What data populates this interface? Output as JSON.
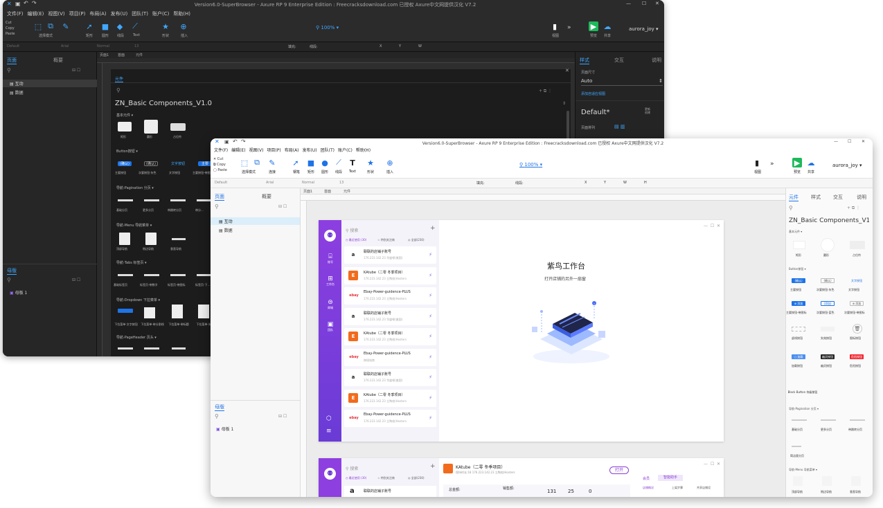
{
  "dark": {
    "title": "Version6.0-SuperBrowser - Axure RP 9 Enterprise Edition : Freecracksdownload.com 已授权   Axure中文网提供汉化 V7.2",
    "menus": [
      "文件(F)",
      "编辑(E)",
      "视图(V)",
      "项目(P)",
      "布局(A)",
      "发布(U)",
      "团队(T)",
      "账户(C)",
      "帮助(H)"
    ],
    "clip": [
      "Cut",
      "Copy",
      "Paste"
    ],
    "toolbar": {
      "select_mode": "选择模式",
      "connect": "连接",
      "pen": "钢笔",
      "rect": "矩形",
      "ellipse": "圆形",
      "line": "线段",
      "text": "Text",
      "shape": "形状",
      "insert": "插入",
      "zoom": "100%",
      "style": "视图",
      "preview": "预览",
      "share": "共享",
      "user": "aurora_joy"
    },
    "fmt": {
      "font": "Default",
      "family": "Arial",
      "weight": "Normal",
      "size": "13",
      "fill": "填充:",
      "border": "线段:",
      "x": "X",
      "y": "Y",
      "w": "W"
    },
    "tabs": [
      "页面1",
      "首面",
      "元件"
    ],
    "left": {
      "tab_pages": "页面",
      "tab_outline": "概要",
      "pages": [
        "互动",
        "数据"
      ],
      "master_title": "母版",
      "masters": [
        "母板 1"
      ]
    },
    "lib": {
      "search_ph": "",
      "title": "ZN_Basic Components_V1.0",
      "basic": "基本元件 ▾",
      "basic_items": [
        "矩形",
        "圆形",
        "占位符"
      ],
      "btn_title": "Button按钮 ▾",
      "btn_items": [
        "主要按钮",
        "次要按钮-灰色",
        "文字按钮",
        "主要按钮-带图标",
        "次要..."
      ],
      "btn_labels": [
        "(确认)",
        "(确认)",
        "文字按钮",
        "主要"
      ],
      "pag_title": "导航-Pagination 分页 ▾",
      "pag_items": [
        "基础分页",
        "更多分页",
        "带跳转分页",
        "带分..."
      ],
      "menu_title": "导航-Menu 导航菜单 ▾",
      "menu_items": [
        "顶部导航",
        "侧边导航",
        "垂直导航"
      ],
      "tabs_title": "导航-Tabs 标签页 ▾",
      "tabs_items": [
        "基础标签页",
        "标签页-带数字",
        "标签页-带图标",
        "标签页-下..."
      ],
      "dd_title": "导航-Dropdown 下拉菜单 ▾",
      "dd_items": [
        "下拉菜单-文字按钮",
        "下拉菜单-带分割线",
        "下拉菜单-带标题",
        "下拉菜单-头..."
      ],
      "ph_title": "导航-PageHeader 页头 ▾"
    },
    "right": {
      "tabs": [
        "样式",
        "交互",
        "说明"
      ],
      "page_size": "页面尺寸",
      "auto": "Auto",
      "add_style": "添加自适应视图",
      "default": "Default*",
      "edit": "更新\n创建",
      "page_arrange": "页面排列"
    }
  },
  "light": {
    "title": "Version6.0-SuperBrowser - Axure RP 9 Enterprise Edition : Freecracksdownload.com 已授权   Axure中文网提供汉化 V7.2",
    "menus": [
      "文件(F)",
      "编辑(E)",
      "视图(V)",
      "项目(P)",
      "布局(A)",
      "发布(U)",
      "团队(T)",
      "账户(C)",
      "帮助(H)"
    ],
    "clip": [
      "Cut",
      "Copy",
      "Paste"
    ],
    "toolbar": {
      "select_mode": "选择模式",
      "connect": "连接",
      "pen": "钢笔",
      "rect": "矩形",
      "ellipse": "圆形",
      "line": "线段",
      "text": "Text",
      "shape": "形状",
      "insert": "插入",
      "zoom": "100%",
      "style": "视图",
      "preview": "预览",
      "share": "共享",
      "user": "aurora_joy"
    },
    "fmt": {
      "font": "Default",
      "family": "Arial",
      "weight": "Normal",
      "size": "13",
      "fill": "填充:",
      "border": "线段:",
      "x": "X",
      "y": "Y",
      "w": "W",
      "h": "H"
    },
    "tabs": [
      "页面1",
      "首面",
      "元件"
    ],
    "left": {
      "tab_pages": "页面",
      "tab_outline": "概要",
      "pages": [
        "互动",
        "数据"
      ],
      "master_title": "母版",
      "masters": [
        "母板 1"
      ]
    },
    "app": {
      "search_ph": "搜索",
      "filter_tabs": [
        "最近使用 (30)",
        "特别关注商",
        "全部(230)"
      ],
      "nav": [
        "账号",
        "工作台",
        "商城",
        "团队"
      ],
      "stores": [
        {
          "name": "联联的店铺子账号",
          "sub": "176.223.142.23  华盛顿(美国)",
          "logo": "a",
          "bg": "#fff",
          "fg": "#222"
        },
        {
          "name": "KAtube（二零 冬季项目）",
          "sub": "176.223.142.23  立陶宛(Hosters",
          "logo": "E",
          "bg": "#f26b1d",
          "fg": "#fff"
        },
        {
          "name": "Ebay-Power-guidence-PLUS",
          "sub": "176.223.142.23  立陶宛(Hosters",
          "logo": "ebay",
          "bg": "#fff",
          "fg": "#e53238"
        },
        {
          "name": "联联的店铺子账号",
          "sub": "176.223.142.23  华盛顿(美国)",
          "logo": "a",
          "bg": "#fff",
          "fg": "#222"
        },
        {
          "name": "KAtube（二零 冬季项目）",
          "sub": "176.223.142.23  立陶宛(Hosters",
          "logo": "E",
          "bg": "#f26b1d",
          "fg": "#fff"
        },
        {
          "name": "Ebay-Power-guidence-PLUS",
          "sub": "跨境电商",
          "logo": "ebay",
          "bg": "#fff",
          "fg": "#e53238"
        },
        {
          "name": "联联的店铺子账号",
          "sub": "176.223.142.23  华盛顿(美国)",
          "logo": "a",
          "bg": "#fff",
          "fg": "#222"
        },
        {
          "name": "KAtube（二零 冬季项目）",
          "sub": "176.223.142.23  立陶宛(Hosters",
          "logo": "E",
          "bg": "#f26b1d",
          "fg": "#fff"
        },
        {
          "name": "Ebay-Power-guidence-PLUS",
          "sub": "176.223.142.23  立陶宛(Hosters",
          "logo": "ebay",
          "bg": "#fff",
          "fg": "#e53238"
        }
      ],
      "welcome": "紫鸟工作台",
      "welcome_sub": "打开店铺的另外一扇窗"
    },
    "app2": {
      "search_ph": "搜索",
      "filter_tabs": [
        "最近使用 (30)",
        "特别关注商",
        "全部(230)"
      ],
      "store_name": "KAtube（二零 冬季项目）",
      "store_sub": "保持时长:18  176.223.142.23  立陶宛(Hosters",
      "open_btn": "打开",
      "tabs": [
        "会员",
        "智能助手"
      ],
      "subtabs": [
        "店铺概况",
        "上架步骤",
        "共享店铺设"
      ],
      "stat1": "总金额:",
      "stat2": "销售额:",
      "nums": [
        "131",
        "25",
        "0"
      ],
      "first_store": "联联的店铺子账号"
    },
    "right": {
      "tabs": [
        "元件",
        "样式",
        "交互",
        "说明"
      ],
      "lib_title": "ZN_Basic Components_V1.",
      "basic": "基本元件 ▾",
      "basic_items": [
        "矩形",
        "圆形",
        "占位符"
      ],
      "btn_title": "Button按钮 ▾",
      "btn_row1": [
        "主要按钮",
        "次要按钮-灰色",
        "文字按钮"
      ],
      "btn_row1_labels": [
        "(确认)",
        "(确认)",
        "文字按钮"
      ],
      "btn_row2": [
        "主要按钮-带图标",
        "次要按钮-蓝色",
        "次要按钮-带图标"
      ],
      "btn_row2_labels": [
        "⊕ 添加",
        "(添加)",
        "⊕ 添加"
      ],
      "btn_row3": [
        "虚线按钮",
        "失效按钮",
        "图标按钮"
      ],
      "btn_row4": [
        "加载按钮",
        "幽灵按钮",
        "危险按钮"
      ],
      "btn_row4_labels": [
        "○ 加载",
        "幽灵按钮",
        "危险按钮"
      ],
      "block_btn": "Block Button 块级按钮",
      "pag_title": "导航-Pagination 分页 ▾",
      "pag_items": [
        "基础分页",
        "更多分页",
        "带跳转分页"
      ],
      "pag_item4": "简洁版分页",
      "menu_title": "导航-Menu 导航菜单 ▾",
      "menu_items": [
        "顶部导航",
        "侧边导航",
        "垂直导航"
      ]
    }
  },
  "colors": {
    "purple": "#8b3fd6",
    "accent": "#1f73e6",
    "dark_accent": "#3fa8ff",
    "ebay": "#e53238",
    "orange": "#f26b1d"
  }
}
